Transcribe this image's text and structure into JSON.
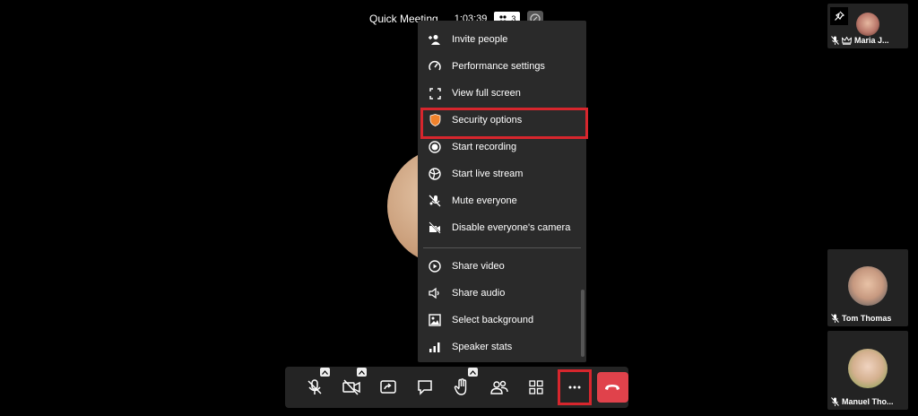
{
  "header": {
    "title": "Quick Meeting",
    "timer": "1:03:39",
    "participant_count": "3"
  },
  "menu": {
    "items": [
      {
        "label": "Invite people",
        "icon": "invite-people-icon"
      },
      {
        "label": "Performance settings",
        "icon": "performance-icon"
      },
      {
        "label": "View full screen",
        "icon": "fullscreen-icon"
      },
      {
        "label": "Security options",
        "icon": "shield-icon",
        "highlighted": true
      },
      {
        "label": "Start recording",
        "icon": "record-icon"
      },
      {
        "label": "Start live stream",
        "icon": "live-stream-icon"
      },
      {
        "label": "Mute everyone",
        "icon": "mute-everyone-icon"
      },
      {
        "label": "Disable everyone's camera",
        "icon": "disable-camera-icon"
      },
      {
        "label": "Share video",
        "icon": "play-circle-icon"
      },
      {
        "label": "Share audio",
        "icon": "speaker-icon"
      },
      {
        "label": "Select background",
        "icon": "image-icon"
      },
      {
        "label": "Speaker stats",
        "icon": "bar-chart-icon"
      }
    ]
  },
  "toolbar": {
    "buttons": [
      "mic-off-icon",
      "camera-off-icon",
      "screen-share-icon",
      "chat-icon",
      "raise-hand-icon",
      "participants-icon",
      "tile-view-icon",
      "more-icon",
      "hangup-icon"
    ]
  },
  "tiles": [
    {
      "name": "Maria J..."
    },
    {
      "name": "Tom Thomas"
    },
    {
      "name": "Manuel Tho..."
    }
  ],
  "colors": {
    "highlight_red": "#d7262d",
    "hangup_red": "#e0424b",
    "menu_bg": "#2a2a2a",
    "shield_orange": "#f0822c"
  }
}
